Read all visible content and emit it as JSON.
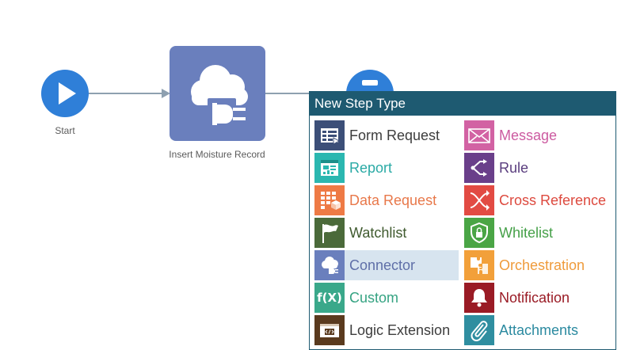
{
  "canvas": {
    "start_label": "Start",
    "step_label": "Insert Moisture Record"
  },
  "popup": {
    "title": "New Step Type",
    "left_items": [
      {
        "label": "Form Request",
        "icon": "form-request-icon",
        "color": "#3c4f78",
        "text_color": "#3d3d3d"
      },
      {
        "label": "Report",
        "icon": "report-icon",
        "color": "#2bb7b0",
        "text_color": "#2aaaa5"
      },
      {
        "label": "Data Request",
        "icon": "data-request-icon",
        "color": "#ee7a45",
        "text_color": "#e8784a"
      },
      {
        "label": "Watchlist",
        "icon": "flag-icon",
        "color": "#4b6a3a",
        "text_color": "#3f5a2e"
      },
      {
        "label": "Connector",
        "icon": "cloud-plug-icon",
        "color": "#6a7fbd",
        "text_color": "#5f6fa8"
      },
      {
        "label": "Custom",
        "icon": "function-icon",
        "color": "#3aa88a",
        "text_color": "#35a382"
      },
      {
        "label": "Logic Extension",
        "icon": "code-window-icon",
        "color": "#5a3a1e",
        "text_color": "#3d3d3d"
      }
    ],
    "right_items": [
      {
        "label": "Message",
        "icon": "envelope-icon",
        "color": "#d262a3",
        "text_color": "#cc5aa0"
      },
      {
        "label": "Rule",
        "icon": "branch-icon",
        "color": "#6a3f8a",
        "text_color": "#5a3d7e"
      },
      {
        "label": "Cross Reference",
        "icon": "cross-reference-icon",
        "color": "#e24b43",
        "text_color": "#dd4a3f"
      },
      {
        "label": "Whitelist",
        "icon": "shield-lock-icon",
        "color": "#4aa545",
        "text_color": "#45a048"
      },
      {
        "label": "Orchestration",
        "icon": "puzzle-icon",
        "color": "#f2a03a",
        "text_color": "#ef9b3b"
      },
      {
        "label": "Notification",
        "icon": "bell-icon",
        "color": "#9a1b25",
        "text_color": "#9a1b25"
      },
      {
        "label": "Attachments",
        "icon": "paperclip-icon",
        "color": "#2f8ea0",
        "text_color": "#2b8aa0"
      }
    ]
  }
}
